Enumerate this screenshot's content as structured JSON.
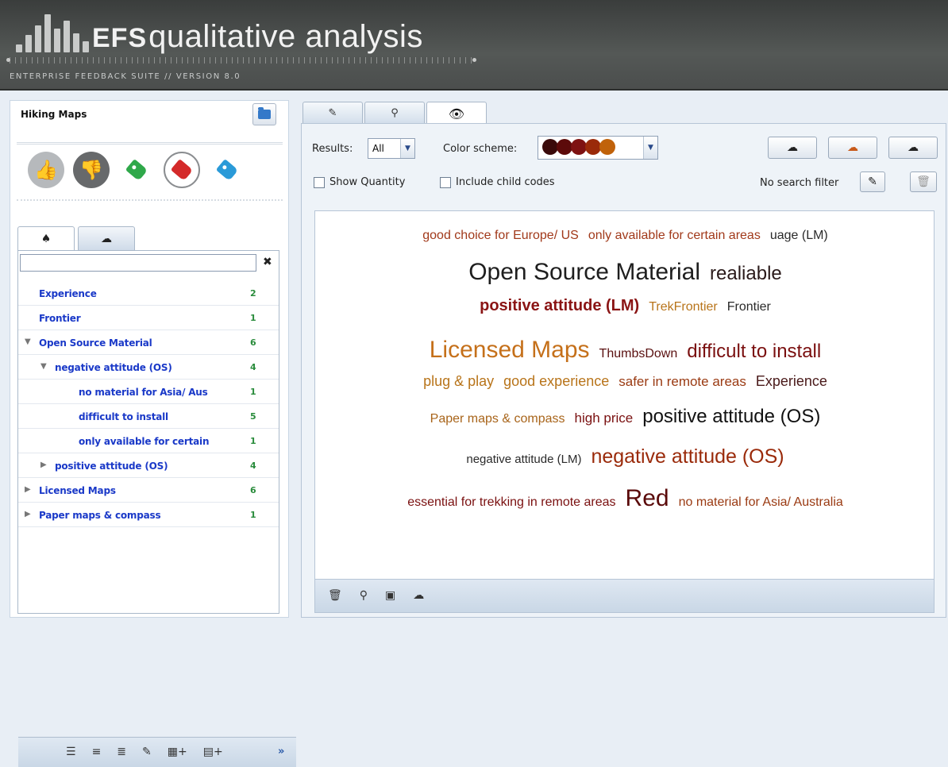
{
  "header": {
    "brand_bold": "EFS",
    "brand_light": "qualitative analysis",
    "subtitle": "ENTERPRISE FEEDBACK SUITE // VERSION 8.0"
  },
  "left": {
    "project_title": "Hiking Maps",
    "tree": [
      {
        "label": "Experience",
        "count": "2",
        "indent": 0,
        "arrow": ""
      },
      {
        "label": "Frontier",
        "count": "1",
        "indent": 0,
        "arrow": ""
      },
      {
        "label": "Open Source Material",
        "count": "6",
        "indent": 0,
        "arrow": "▼"
      },
      {
        "label": "negative attitude (OS)",
        "count": "4",
        "indent": 1,
        "arrow": "▼"
      },
      {
        "label": "no material for Asia/ Aus",
        "count": "1",
        "indent": 2,
        "arrow": ""
      },
      {
        "label": "difficult to install",
        "count": "5",
        "indent": 2,
        "arrow": ""
      },
      {
        "label": "only available for certain",
        "count": "1",
        "indent": 2,
        "arrow": ""
      },
      {
        "label": "positive attitude (OS)",
        "count": "4",
        "indent": 1,
        "arrow": "▶"
      },
      {
        "label": "Licensed Maps",
        "count": "6",
        "indent": 0,
        "arrow": "▶"
      },
      {
        "label": "Paper maps & compass",
        "count": "1",
        "indent": 0,
        "arrow": "▶"
      }
    ]
  },
  "right": {
    "results_label": "Results:",
    "results_value": "All",
    "color_scheme_label": "Color scheme:",
    "color_scheme_swatches": [
      "#3a0a0a",
      "#5c0a0a",
      "#7e1212",
      "#9a2a0a",
      "#c0620a"
    ],
    "show_quantity_label": "Show Quantity",
    "include_child_label": "Include child codes",
    "search_filter_label": "No search filter"
  },
  "cloud": [
    [
      {
        "text": "good choice for Europe/ US",
        "size": 16,
        "color": "#a1391a"
      },
      {
        "text": "only available for certain areas",
        "size": 16,
        "color": "#a1391a"
      },
      {
        "text": "uage (LM)",
        "size": 16,
        "color": "#2a2a2a"
      }
    ],
    [
      {
        "text": "Open Source Material",
        "size": 30,
        "color": "#1e1e1e"
      },
      {
        "text": "realiable",
        "size": 24,
        "color": "#2a1a1a"
      }
    ],
    [
      {
        "text": "positive attitude (LM)",
        "size": 20,
        "color": "#8a1414",
        "bold": true
      },
      {
        "text": "TrekFrontier",
        "size": 16,
        "color": "#b8741a"
      },
      {
        "text": "Frontier",
        "size": 16,
        "color": "#2a2a2a"
      }
    ],
    [
      {
        "text": "Licensed Maps",
        "size": 30,
        "color": "#c5701a"
      },
      {
        "text": "ThumbsDown",
        "size": 16,
        "color": "#5a1010"
      },
      {
        "text": "difficult to install",
        "size": 24,
        "color": "#7a0f0f"
      }
    ],
    [
      {
        "text": "plug & play",
        "size": 18,
        "color": "#b8741a"
      },
      {
        "text": "good experience",
        "size": 18,
        "color": "#b8741a"
      },
      {
        "text": "safer in remote areas",
        "size": 17,
        "color": "#9a3a12"
      },
      {
        "text": "Experience",
        "size": 18,
        "color": "#4a1a1a"
      }
    ],
    [
      {
        "text": "Paper maps & compass",
        "size": 16,
        "color": "#a8641a"
      },
      {
        "text": "high price",
        "size": 17,
        "color": "#7a1010"
      },
      {
        "text": "positive attitude (OS)",
        "size": 24,
        "color": "#111111"
      }
    ],
    [
      {
        "text": "negative attitude (LM)",
        "size": 15,
        "color": "#2a2a2a"
      },
      {
        "text": "negative attitude (OS)",
        "size": 25,
        "color": "#9a2a0a"
      }
    ],
    [
      {
        "text": "essential for trekking in remote areas",
        "size": 16,
        "color": "#7a1010"
      },
      {
        "text": "Red",
        "size": 30,
        "color": "#5a0a0a"
      },
      {
        "text": "no material for Asia/ Australia",
        "size": 16,
        "color": "#9a3a12"
      }
    ]
  ]
}
